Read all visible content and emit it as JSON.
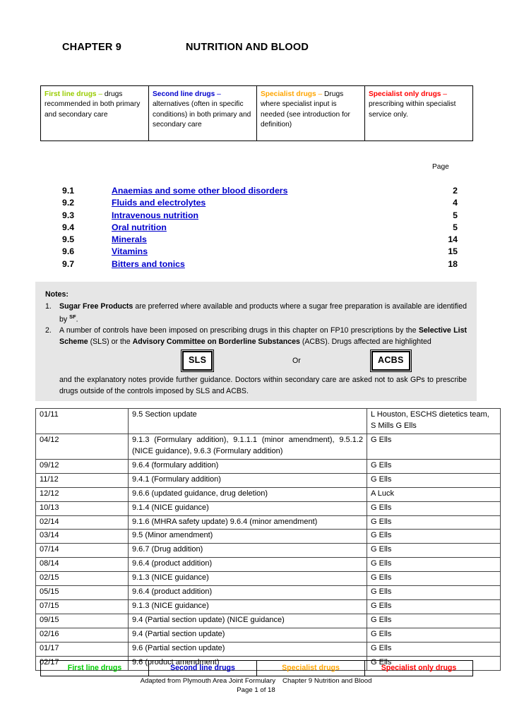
{
  "document": {
    "chapter_label": "CHAPTER 9",
    "chapter_title": "NUTRITION AND BLOOD"
  },
  "colors": {
    "first_line": "#99CC00",
    "first_line_footer": "#00CC00",
    "second_line": "#0000CC",
    "specialist": "#FFA500",
    "specialist_only": "#FF0000",
    "link": "#0000CC",
    "notes_background": "#E6E6E6"
  },
  "legend_top": [
    {
      "term": "First line drugs",
      "dash": " – ",
      "description": "drugs recommended in both primary and secondary care",
      "color_key": "first_line"
    },
    {
      "term": "Second line drugs",
      "dash": " – ",
      "description": "alternatives (often in specific conditions) in both primary and secondary care",
      "color_key": "second_line"
    },
    {
      "term": "Specialist drugs",
      "dash": " – ",
      "description": "Drugs where specialist input is needed (see introduction for definition)",
      "color_key": "specialist"
    },
    {
      "term": "Specialist only drugs",
      "dash": " – ",
      "description": "prescribing within specialist service only.",
      "color_key": "specialist_only"
    }
  ],
  "toc": {
    "page_header": "Page",
    "entries": [
      {
        "number": "9.1",
        "title": "Anaemias and some other blood disorders",
        "page": "2"
      },
      {
        "number": "9.2",
        "title": "Fluids and electrolytes",
        "page": "4"
      },
      {
        "number": "9.3",
        "title": "Intravenous nutrition",
        "page": "5"
      },
      {
        "number": "9.4",
        "title": "Oral nutrition",
        "page": "5"
      },
      {
        "number": "9.5",
        "title": "Minerals",
        "page": "14"
      },
      {
        "number": "9.6",
        "title": "Vitamins",
        "page": "15"
      },
      {
        "number": "9.7",
        "title": "Bitters and tonics",
        "page": "18"
      }
    ]
  },
  "notes": {
    "heading": "Notes:",
    "item1": {
      "marker": "1.",
      "bold_lead": "Sugar Free Products",
      "text_a": " are preferred where available and products where a sugar free preparation is available are identified by ",
      "superscript": "SF",
      "text_b": "."
    },
    "item2": {
      "marker": "2.",
      "text_a": "A number of controls have been imposed on prescribing drugs in this chapter on FP10 prescriptions by the ",
      "bold_a": "Selective List Scheme",
      "text_b": " (SLS) or the ",
      "bold_b": "Advisory Committee on Borderline Substances",
      "text_c": " (ACBS). Drugs affected are highlighted"
    },
    "tag_sls": "SLS",
    "tag_or": "Or",
    "tag_acbs": "ACBS",
    "tail": "and the explanatory notes provide further guidance. Doctors within secondary care are asked not to ask GPs to prescribe drugs outside of the controls imposed by SLS and ACBS."
  },
  "revision_table": {
    "rows": [
      {
        "date": "01/11",
        "description": "9.5 Section update",
        "author": "L Houston, ESCHS dietetics team, S Mills G Ells",
        "justify": false
      },
      {
        "date": "04/12",
        "description": "9.1.3 (Formulary addition), 9.1.1.1 (minor amendment), 9.5.1.2 (NICE guidance), 9.6.3 (Formulary addition)",
        "author": "G Ells",
        "justify": true
      },
      {
        "date": "09/12",
        "description": "9.6.4 (formulary addition)",
        "author": "G Ells",
        "justify": false
      },
      {
        "date": "11/12",
        "description": "9.4.1 (Formulary addition)",
        "author": "G Ells",
        "justify": false
      },
      {
        "date": "12/12",
        "description": "9.6.6 (updated guidance, drug deletion)",
        "author": "A Luck",
        "justify": false
      },
      {
        "date": "10/13",
        "description": "9.1.4 (NICE guidance)",
        "author": "G Ells",
        "justify": false
      },
      {
        "date": "02/14",
        "description": "9.1.6 (MHRA safety update) 9.6.4 (minor amendment)",
        "author": "G Ells",
        "justify": true
      },
      {
        "date": "03/14",
        "description": "9.5 (Minor amendment)",
        "author": "G Ells",
        "justify": false
      },
      {
        "date": "07/14",
        "description": "9.6.7 (Drug addition)",
        "author": "G Ells",
        "justify": false
      },
      {
        "date": "08/14",
        "description": "9.6.4 (product addition)",
        "author": "G Ells",
        "justify": false
      },
      {
        "date": "02/15",
        "description": "9.1.3 (NICE guidance)",
        "author": "G Ells",
        "justify": false
      },
      {
        "date": "05/15",
        "description": "9.6.4 (product addition)",
        "author": "G Ells",
        "justify": false
      },
      {
        "date": "07/15",
        "description": "9.1.3 (NICE guidance)",
        "author": "G Ells",
        "justify": false
      },
      {
        "date": "09/15",
        "description": "9.4  (Partial section update) (NICE guidance)",
        "author": "G Ells",
        "justify": false
      },
      {
        "date": "02/16",
        "description": "9.4 (Partial section update)",
        "author": "G Ells",
        "justify": false
      },
      {
        "date": "01/17",
        "description": "9.6 (Partial section update)",
        "author": "G Ells",
        "justify": false
      },
      {
        "date": "02/17",
        "description": "9.6 (product amendment)",
        "author": "G Ells",
        "justify": false
      }
    ]
  },
  "legend_footer": [
    {
      "label": "First line drugs",
      "color_key": "first_line_footer"
    },
    {
      "label": "Second line drugs",
      "color_key": "second_line"
    },
    {
      "label": "Specialist drugs",
      "color_key": "specialist"
    },
    {
      "label": "Specialist only drugs",
      "color_key": "specialist_only"
    }
  ],
  "page_footer": {
    "line1_a": "Adapted from Plymouth Area Joint Formulary",
    "line1_b": "Chapter 9 Nutrition and Blood",
    "line2": "Page 1 of 18"
  }
}
